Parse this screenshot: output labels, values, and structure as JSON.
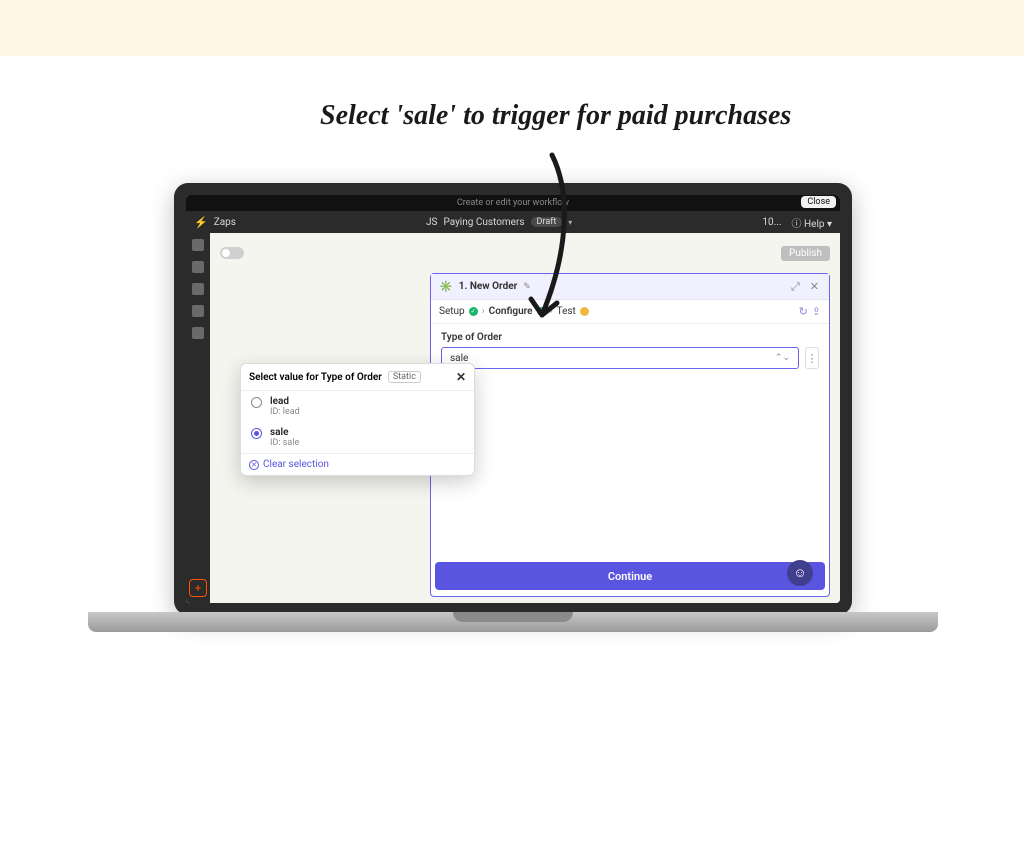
{
  "annotation": "Select 'sale' to trigger for paid purchases",
  "top_black_text": "Create or edit your workflow",
  "close_chip": "Close",
  "zap_bar": {
    "title": "Zaps",
    "workflow_prefix": "JS",
    "workflow_name": "Paying Customers",
    "draft": "Draft",
    "zoom": "10...",
    "help": "Help"
  },
  "publish_btn": "Publish",
  "panel": {
    "step_label": "1. New Order",
    "tabs": {
      "setup": "Setup",
      "configure": "Configure",
      "test": "Test"
    },
    "field_label": "Type of Order",
    "field_value": "sale",
    "continue": "Continue"
  },
  "popover": {
    "title": "Select value for Type of Order",
    "static": "Static",
    "options": [
      {
        "name": "lead",
        "id": "ID: lead",
        "selected": false
      },
      {
        "name": "sale",
        "id": "ID: sale",
        "selected": true
      }
    ],
    "clear": "Clear selection"
  }
}
